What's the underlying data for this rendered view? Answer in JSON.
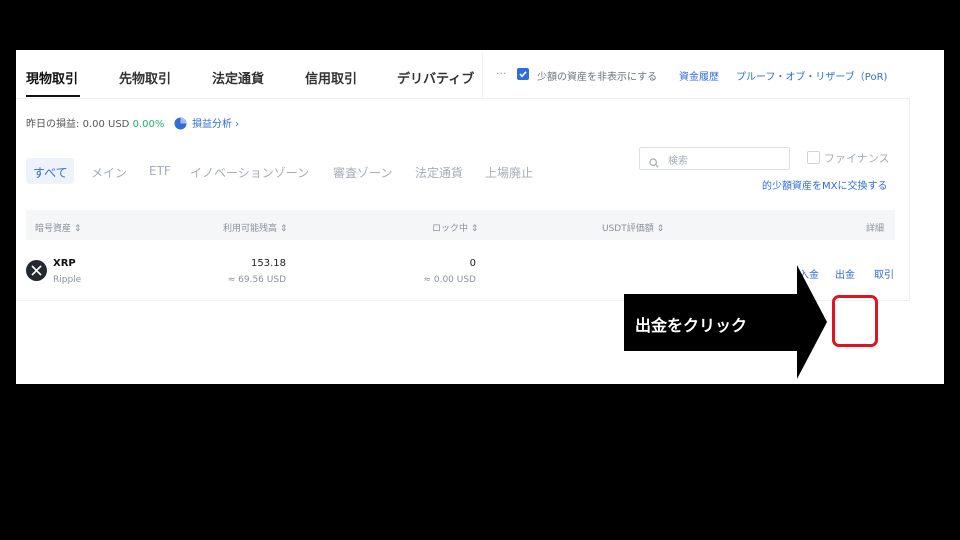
{
  "tabs": [
    {
      "label": "現物取引",
      "active": true
    },
    {
      "label": "先物取引"
    },
    {
      "label": "法定通貨"
    },
    {
      "label": "信用取引"
    },
    {
      "label": "デリバティブ"
    }
  ],
  "toolbar": {
    "more": "···",
    "hide_small_checked": true,
    "hide_small_label": "少額の資産を非表示にする",
    "history_link": "資金履歴",
    "por_link": "プルーフ・オブ・リザーブ（PoR)"
  },
  "pnl": {
    "label": "昨日の損益:",
    "value": "0.00 USD",
    "percent": "0.00%",
    "analysis_link": "損益分析 ›"
  },
  "filters": {
    "active": "すべて",
    "items": [
      "メイン",
      "ETF",
      "イノベーションゾーン",
      "審査ゾーン",
      "法定通貨",
      "上場廃止"
    ]
  },
  "search": {
    "placeholder": "検索"
  },
  "finance": {
    "label": "ファイナンス",
    "checked": false
  },
  "convert_link": "的少額資産をMXに交換する",
  "table": {
    "headers": {
      "asset": "暗号資産 ⇕",
      "available": "利用可能残高 ⇕",
      "locked": "ロック中 ⇕",
      "usdt_value": "USDT評価額 ⇕",
      "detail": "詳細"
    },
    "rows": [
      {
        "symbol": "XRP",
        "name": "Ripple",
        "available": "153.18",
        "available_usd": "≈ 69.56 USD",
        "locked": "0",
        "locked_usd": "≈ 0.00 USD",
        "actions": {
          "deposit": "入金",
          "withdraw": "出金",
          "trade": "取引"
        }
      }
    ]
  },
  "callout": {
    "text": "出金をクリック"
  },
  "colors": {
    "accent": "#2f6dd8",
    "positive": "#20b26c",
    "highlight": "#e0141e"
  }
}
